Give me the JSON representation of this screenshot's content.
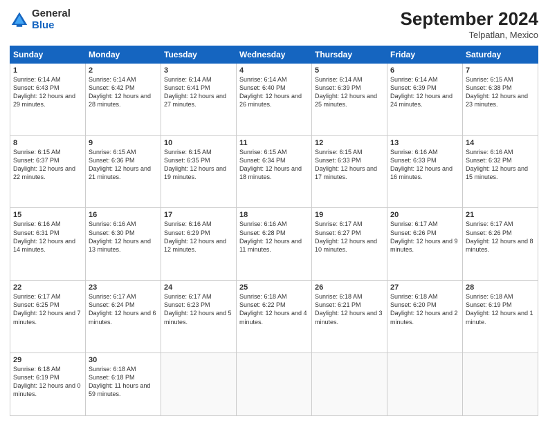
{
  "header": {
    "logo_general": "General",
    "logo_blue": "Blue",
    "month_title": "September 2024",
    "location": "Telpatlan, Mexico"
  },
  "days_of_week": [
    "Sunday",
    "Monday",
    "Tuesday",
    "Wednesday",
    "Thursday",
    "Friday",
    "Saturday"
  ],
  "weeks": [
    [
      {
        "day": 1,
        "sunrise": "6:14 AM",
        "sunset": "6:43 PM",
        "daylight": "12 hours and 29 minutes."
      },
      {
        "day": 2,
        "sunrise": "6:14 AM",
        "sunset": "6:42 PM",
        "daylight": "12 hours and 28 minutes."
      },
      {
        "day": 3,
        "sunrise": "6:14 AM",
        "sunset": "6:41 PM",
        "daylight": "12 hours and 27 minutes."
      },
      {
        "day": 4,
        "sunrise": "6:14 AM",
        "sunset": "6:40 PM",
        "daylight": "12 hours and 26 minutes."
      },
      {
        "day": 5,
        "sunrise": "6:14 AM",
        "sunset": "6:39 PM",
        "daylight": "12 hours and 25 minutes."
      },
      {
        "day": 6,
        "sunrise": "6:14 AM",
        "sunset": "6:39 PM",
        "daylight": "12 hours and 24 minutes."
      },
      {
        "day": 7,
        "sunrise": "6:15 AM",
        "sunset": "6:38 PM",
        "daylight": "12 hours and 23 minutes."
      }
    ],
    [
      {
        "day": 8,
        "sunrise": "6:15 AM",
        "sunset": "6:37 PM",
        "daylight": "12 hours and 22 minutes."
      },
      {
        "day": 9,
        "sunrise": "6:15 AM",
        "sunset": "6:36 PM",
        "daylight": "12 hours and 21 minutes."
      },
      {
        "day": 10,
        "sunrise": "6:15 AM",
        "sunset": "6:35 PM",
        "daylight": "12 hours and 19 minutes."
      },
      {
        "day": 11,
        "sunrise": "6:15 AM",
        "sunset": "6:34 PM",
        "daylight": "12 hours and 18 minutes."
      },
      {
        "day": 12,
        "sunrise": "6:15 AM",
        "sunset": "6:33 PM",
        "daylight": "12 hours and 17 minutes."
      },
      {
        "day": 13,
        "sunrise": "6:16 AM",
        "sunset": "6:33 PM",
        "daylight": "12 hours and 16 minutes."
      },
      {
        "day": 14,
        "sunrise": "6:16 AM",
        "sunset": "6:32 PM",
        "daylight": "12 hours and 15 minutes."
      }
    ],
    [
      {
        "day": 15,
        "sunrise": "6:16 AM",
        "sunset": "6:31 PM",
        "daylight": "12 hours and 14 minutes."
      },
      {
        "day": 16,
        "sunrise": "6:16 AM",
        "sunset": "6:30 PM",
        "daylight": "12 hours and 13 minutes."
      },
      {
        "day": 17,
        "sunrise": "6:16 AM",
        "sunset": "6:29 PM",
        "daylight": "12 hours and 12 minutes."
      },
      {
        "day": 18,
        "sunrise": "6:16 AM",
        "sunset": "6:28 PM",
        "daylight": "12 hours and 11 minutes."
      },
      {
        "day": 19,
        "sunrise": "6:17 AM",
        "sunset": "6:27 PM",
        "daylight": "12 hours and 10 minutes."
      },
      {
        "day": 20,
        "sunrise": "6:17 AM",
        "sunset": "6:26 PM",
        "daylight": "12 hours and 9 minutes."
      },
      {
        "day": 21,
        "sunrise": "6:17 AM",
        "sunset": "6:26 PM",
        "daylight": "12 hours and 8 minutes."
      }
    ],
    [
      {
        "day": 22,
        "sunrise": "6:17 AM",
        "sunset": "6:25 PM",
        "daylight": "12 hours and 7 minutes."
      },
      {
        "day": 23,
        "sunrise": "6:17 AM",
        "sunset": "6:24 PM",
        "daylight": "12 hours and 6 minutes."
      },
      {
        "day": 24,
        "sunrise": "6:17 AM",
        "sunset": "6:23 PM",
        "daylight": "12 hours and 5 minutes."
      },
      {
        "day": 25,
        "sunrise": "6:18 AM",
        "sunset": "6:22 PM",
        "daylight": "12 hours and 4 minutes."
      },
      {
        "day": 26,
        "sunrise": "6:18 AM",
        "sunset": "6:21 PM",
        "daylight": "12 hours and 3 minutes."
      },
      {
        "day": 27,
        "sunrise": "6:18 AM",
        "sunset": "6:20 PM",
        "daylight": "12 hours and 2 minutes."
      },
      {
        "day": 28,
        "sunrise": "6:18 AM",
        "sunset": "6:19 PM",
        "daylight": "12 hours and 1 minute."
      }
    ],
    [
      {
        "day": 29,
        "sunrise": "6:18 AM",
        "sunset": "6:19 PM",
        "daylight": "12 hours and 0 minutes."
      },
      {
        "day": 30,
        "sunrise": "6:18 AM",
        "sunset": "6:18 PM",
        "daylight": "11 hours and 59 minutes."
      },
      null,
      null,
      null,
      null,
      null
    ]
  ]
}
